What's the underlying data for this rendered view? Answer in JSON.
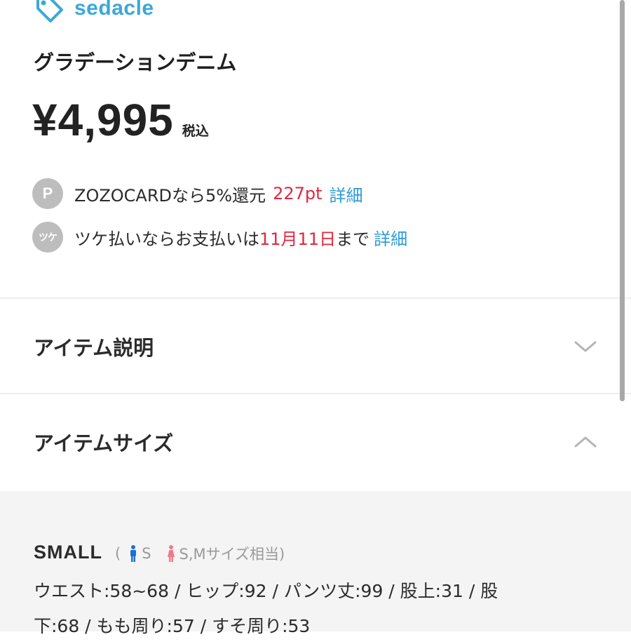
{
  "brand": {
    "name": "sedacle",
    "icon": "price-tag-icon",
    "color": "#3aa8d8"
  },
  "product": {
    "title": "グラデーションデニム",
    "price": "¥4,995",
    "tax_label": "税込"
  },
  "benefits": [
    {
      "badge": "P",
      "icon": "points-badge-icon",
      "text": "ZOZOCARDなら5%還元",
      "highlight": "227pt",
      "link": "詳細"
    },
    {
      "badge": "ツケ",
      "icon": "tsuke-badge-icon",
      "text_before": "ツケ払いならお支払いは",
      "highlight": "11月11日",
      "text_after": "まで",
      "link": "詳細"
    }
  ],
  "sections": {
    "description": {
      "label": "アイテム説明",
      "state": "collapsed",
      "icon": "chevron-down-icon"
    },
    "size": {
      "label": "アイテムサイズ",
      "state": "expanded",
      "icon": "chevron-up-icon"
    }
  },
  "size_table": [
    {
      "name": "SMALL",
      "open_paren": "(",
      "men_icon": "male-icon",
      "men_size": "S",
      "women_icon": "female-icon",
      "women_size": "S,Mサイズ相当)",
      "measurements_line1": "ウエスト:58~68 / ヒップ:92 / パンツ丈:99 / 股上:31 / 股",
      "measurements_line2": "下:68 / もも周り:57 / すそ周り:53"
    }
  ],
  "colors": {
    "accent_red": "#e0273e",
    "link_blue": "#2d9ad6",
    "men_blue": "#1f6fd0",
    "women_pink": "#f07a8a"
  }
}
